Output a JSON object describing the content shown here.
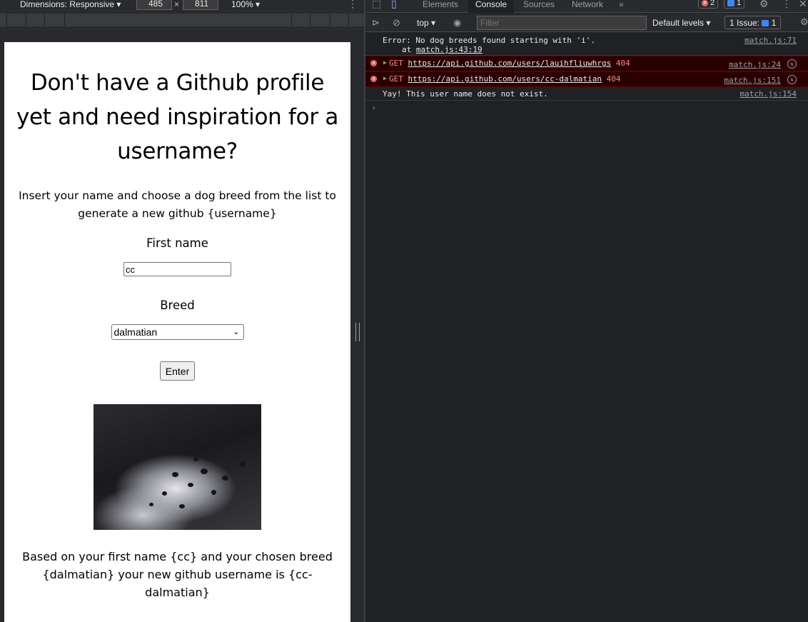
{
  "device_toolbar": {
    "dimensions_label": "Dimensions: Responsive ▾",
    "width": "485",
    "times": "×",
    "height": "811",
    "zoom": "100% ▾"
  },
  "page": {
    "heading": "Don't have a Github profile yet and need inspiration for a username?",
    "intro": "Insert your name and choose a dog breed from the list to generate a new github {username}",
    "first_name_label": "First name",
    "first_name_value": "cc",
    "breed_label": "Breed",
    "breed_selected": "dalmatian",
    "enter_label": "Enter",
    "result": "Based on your first name {cc} and your chosen breed {dalmatian} your new github username is {cc-dalmatian}"
  },
  "devtools": {
    "tabs": [
      "Elements",
      "Console",
      "Sources",
      "Network"
    ],
    "active_tab": "Console",
    "more_tabs": "»",
    "error_count": "2",
    "message_count": "1",
    "console_toolbar": {
      "context": "top ▾",
      "filter_placeholder": "Filter",
      "levels": "Default levels ▾",
      "issues_label": "1 Issue:",
      "issues_count": "1"
    },
    "messages": [
      {
        "type": "log",
        "text": "Error: No dog breeds found starting with 'i'.",
        "stack": "at match.js:43:19",
        "stack_link": "match.js:43:19",
        "source": "match.js:71"
      },
      {
        "type": "error",
        "method": "GET",
        "url": "https://api.github.com/users/lauihfliuwhrgs",
        "status": "404",
        "source": "match.js:24"
      },
      {
        "type": "error",
        "method": "GET",
        "url": "https://api.github.com/users/cc-dalmatian",
        "status": "404",
        "source": "match.js:151"
      },
      {
        "type": "log",
        "text": "Yay! This user name does not exist.",
        "source": "match.js:154"
      }
    ],
    "prompt": "›"
  },
  "colors": {
    "devtools_bg": "#202124",
    "error_row_bg": "#290000",
    "error_text": "#f28b82",
    "prompt_blue": "#4d90fe"
  }
}
